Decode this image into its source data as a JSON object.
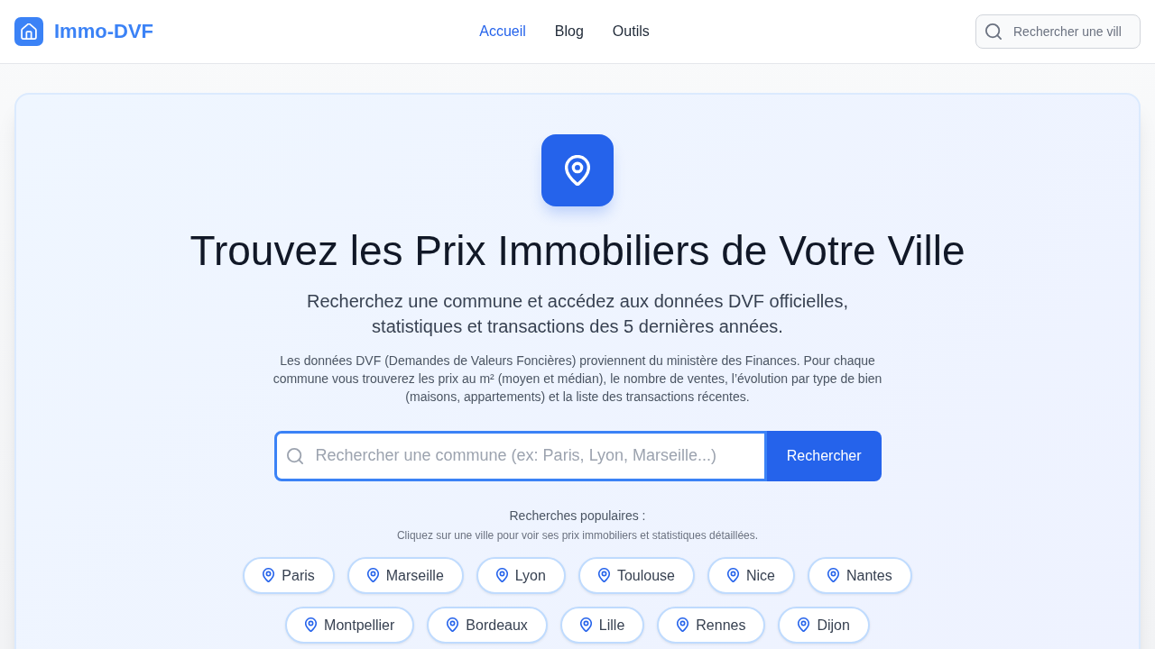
{
  "header": {
    "logo_text": "Immo-DVF",
    "nav": [
      {
        "label": "Accueil",
        "selected": true
      },
      {
        "label": "Blog",
        "selected": false
      },
      {
        "label": "Outils",
        "selected": false
      }
    ],
    "search": {
      "placeholder": "Rechercher une vill"
    }
  },
  "hero": {
    "title": "Trouvez les Prix Immobiliers de Votre Ville",
    "subtitle": "Recherchez une commune et accédez aux données DVF officielles, statistiques et transactions des 5 dernières années.",
    "description": "Les données DVF (Demandes de Valeurs Foncières) proviennent du ministère des Finances. Pour chaque commune vous trouverez les prix au m² (moyen et médian), le nombre de ventes, l’évolution par type de bien (maisons, appartements) et la liste des transactions récentes.",
    "search": {
      "placeholder": "Rechercher une commune (ex: Paris, Lyon, Marseille...)",
      "button": "Rechercher"
    },
    "popular": {
      "heading": "Recherches populaires :",
      "hint": "Cliquez sur une ville pour voir ses prix immobiliers et statistiques détaillées.",
      "cities": [
        "Paris",
        "Marseille",
        "Lyon",
        "Toulouse",
        "Nice",
        "Nantes",
        "Montpellier",
        "Bordeaux",
        "Lille",
        "Rennes",
        "Dijon"
      ]
    }
  }
}
